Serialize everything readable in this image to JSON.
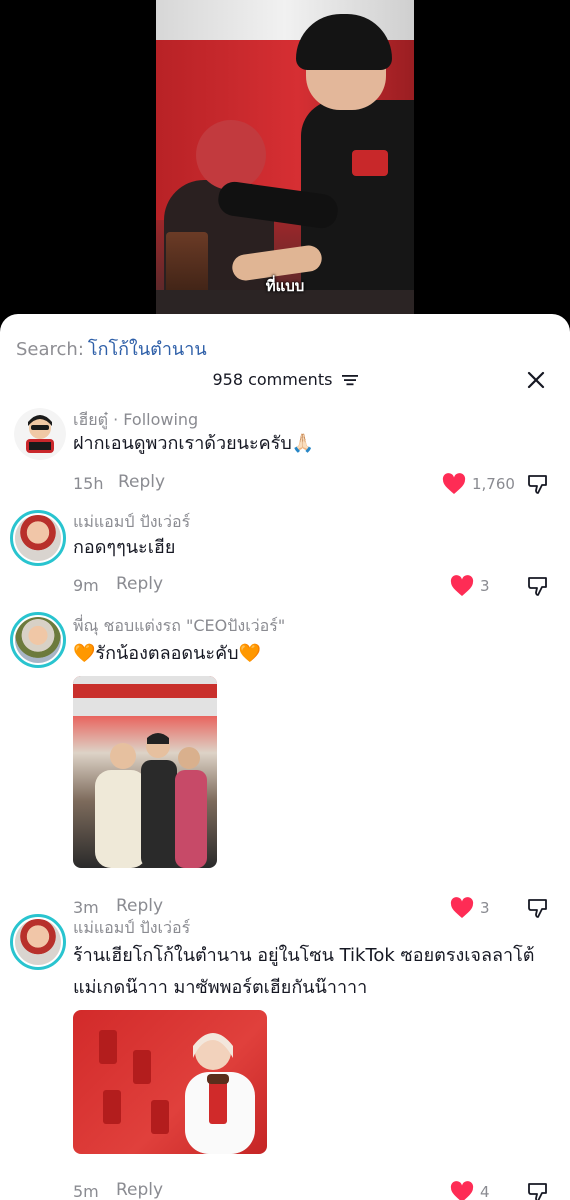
{
  "video": {
    "subtitle": "ที่แบบ"
  },
  "search": {
    "label": "Search:",
    "query": "โกโก้ในตำนาน"
  },
  "header": {
    "comment_count": "958 comments",
    "filter_icon": "filter-lines-icon",
    "close_icon": "close-x-icon"
  },
  "colors": {
    "like_red": "#fe2c55",
    "link_blue": "#2e5fa8",
    "gray_text": "#8a8b91",
    "ring_teal": "#29c4cf"
  },
  "comments": [
    {
      "username": "เฮียตู๋",
      "badge": "Following",
      "text": "ฝากเอนดูพวกเราด้วยนะครับ🙏🏻",
      "time": "15h",
      "reply_label": "Reply",
      "likes": "1,760"
    },
    {
      "username": "แม่แอมป์ ปังเว่อร์",
      "text": "กอดๆๆนะเฮีย",
      "time": "9m",
      "reply_label": "Reply",
      "likes": "3"
    },
    {
      "username": "พี่ณุ ชอบแต่งรถ \"CEOปังเว่อร์\"",
      "text": "🧡รักน้องตลอดนะคับ🧡",
      "time": "3m",
      "reply_label": "Reply",
      "likes": "3"
    },
    {
      "username": "แม่แอมป์ ปังเว่อร์",
      "text_line1": "ร้านเฮียโกโก้ในตำนาน อยู่ในโซน TikTok ซอยตรงเจลลาโต้",
      "text_line2": "แม่เกดน๊าาา มาซัพพอร์ตเฮียกันน๊าาาา",
      "time": "5m",
      "reply_label": "Reply",
      "likes": "4"
    }
  ]
}
